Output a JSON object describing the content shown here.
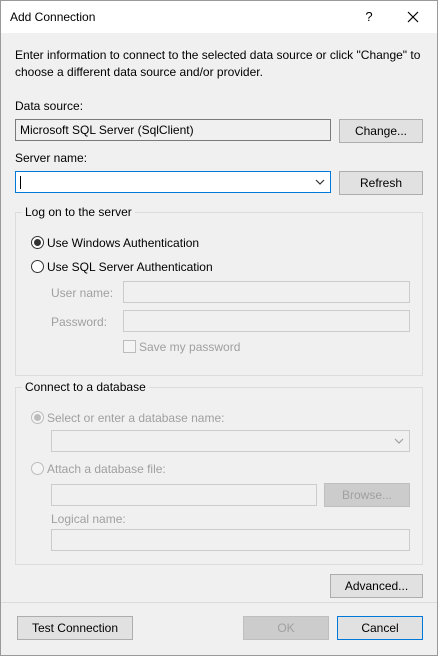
{
  "dialog": {
    "title": "Add Connection",
    "help_glyph": "?",
    "close_label": "Close",
    "instructions": "Enter information to connect to the selected data source or click \"Change\" to choose a different data source and/or provider."
  },
  "data_source": {
    "label": "Data source:",
    "value": "Microsoft SQL Server (SqlClient)",
    "change_button": "Change..."
  },
  "server": {
    "label": "Server name:",
    "value": "",
    "refresh_button": "Refresh"
  },
  "logon": {
    "group_title": "Log on to the server",
    "windows_auth": "Use Windows Authentication",
    "sql_auth": "Use SQL Server Authentication",
    "selected": "windows",
    "user_name_label": "User name:",
    "user_name_value": "",
    "password_label": "Password:",
    "password_value": "",
    "save_password": "Save my password",
    "save_password_checked": false
  },
  "database": {
    "group_title": "Connect to a database",
    "select_option": "Select or enter a database name:",
    "database_name_value": "",
    "attach_option": "Attach a database file:",
    "attach_file_value": "",
    "browse_button": "Browse...",
    "logical_name_label": "Logical name:",
    "logical_name_value": ""
  },
  "footer": {
    "advanced_button": "Advanced...",
    "test_button": "Test Connection",
    "ok_button": "OK",
    "cancel_button": "Cancel"
  },
  "colors": {
    "focus_border": "#0078d7",
    "disabled_text": "#a0a0a0",
    "window_bg": "#f0f0f0",
    "titlebar_bg": "#ffffff"
  }
}
